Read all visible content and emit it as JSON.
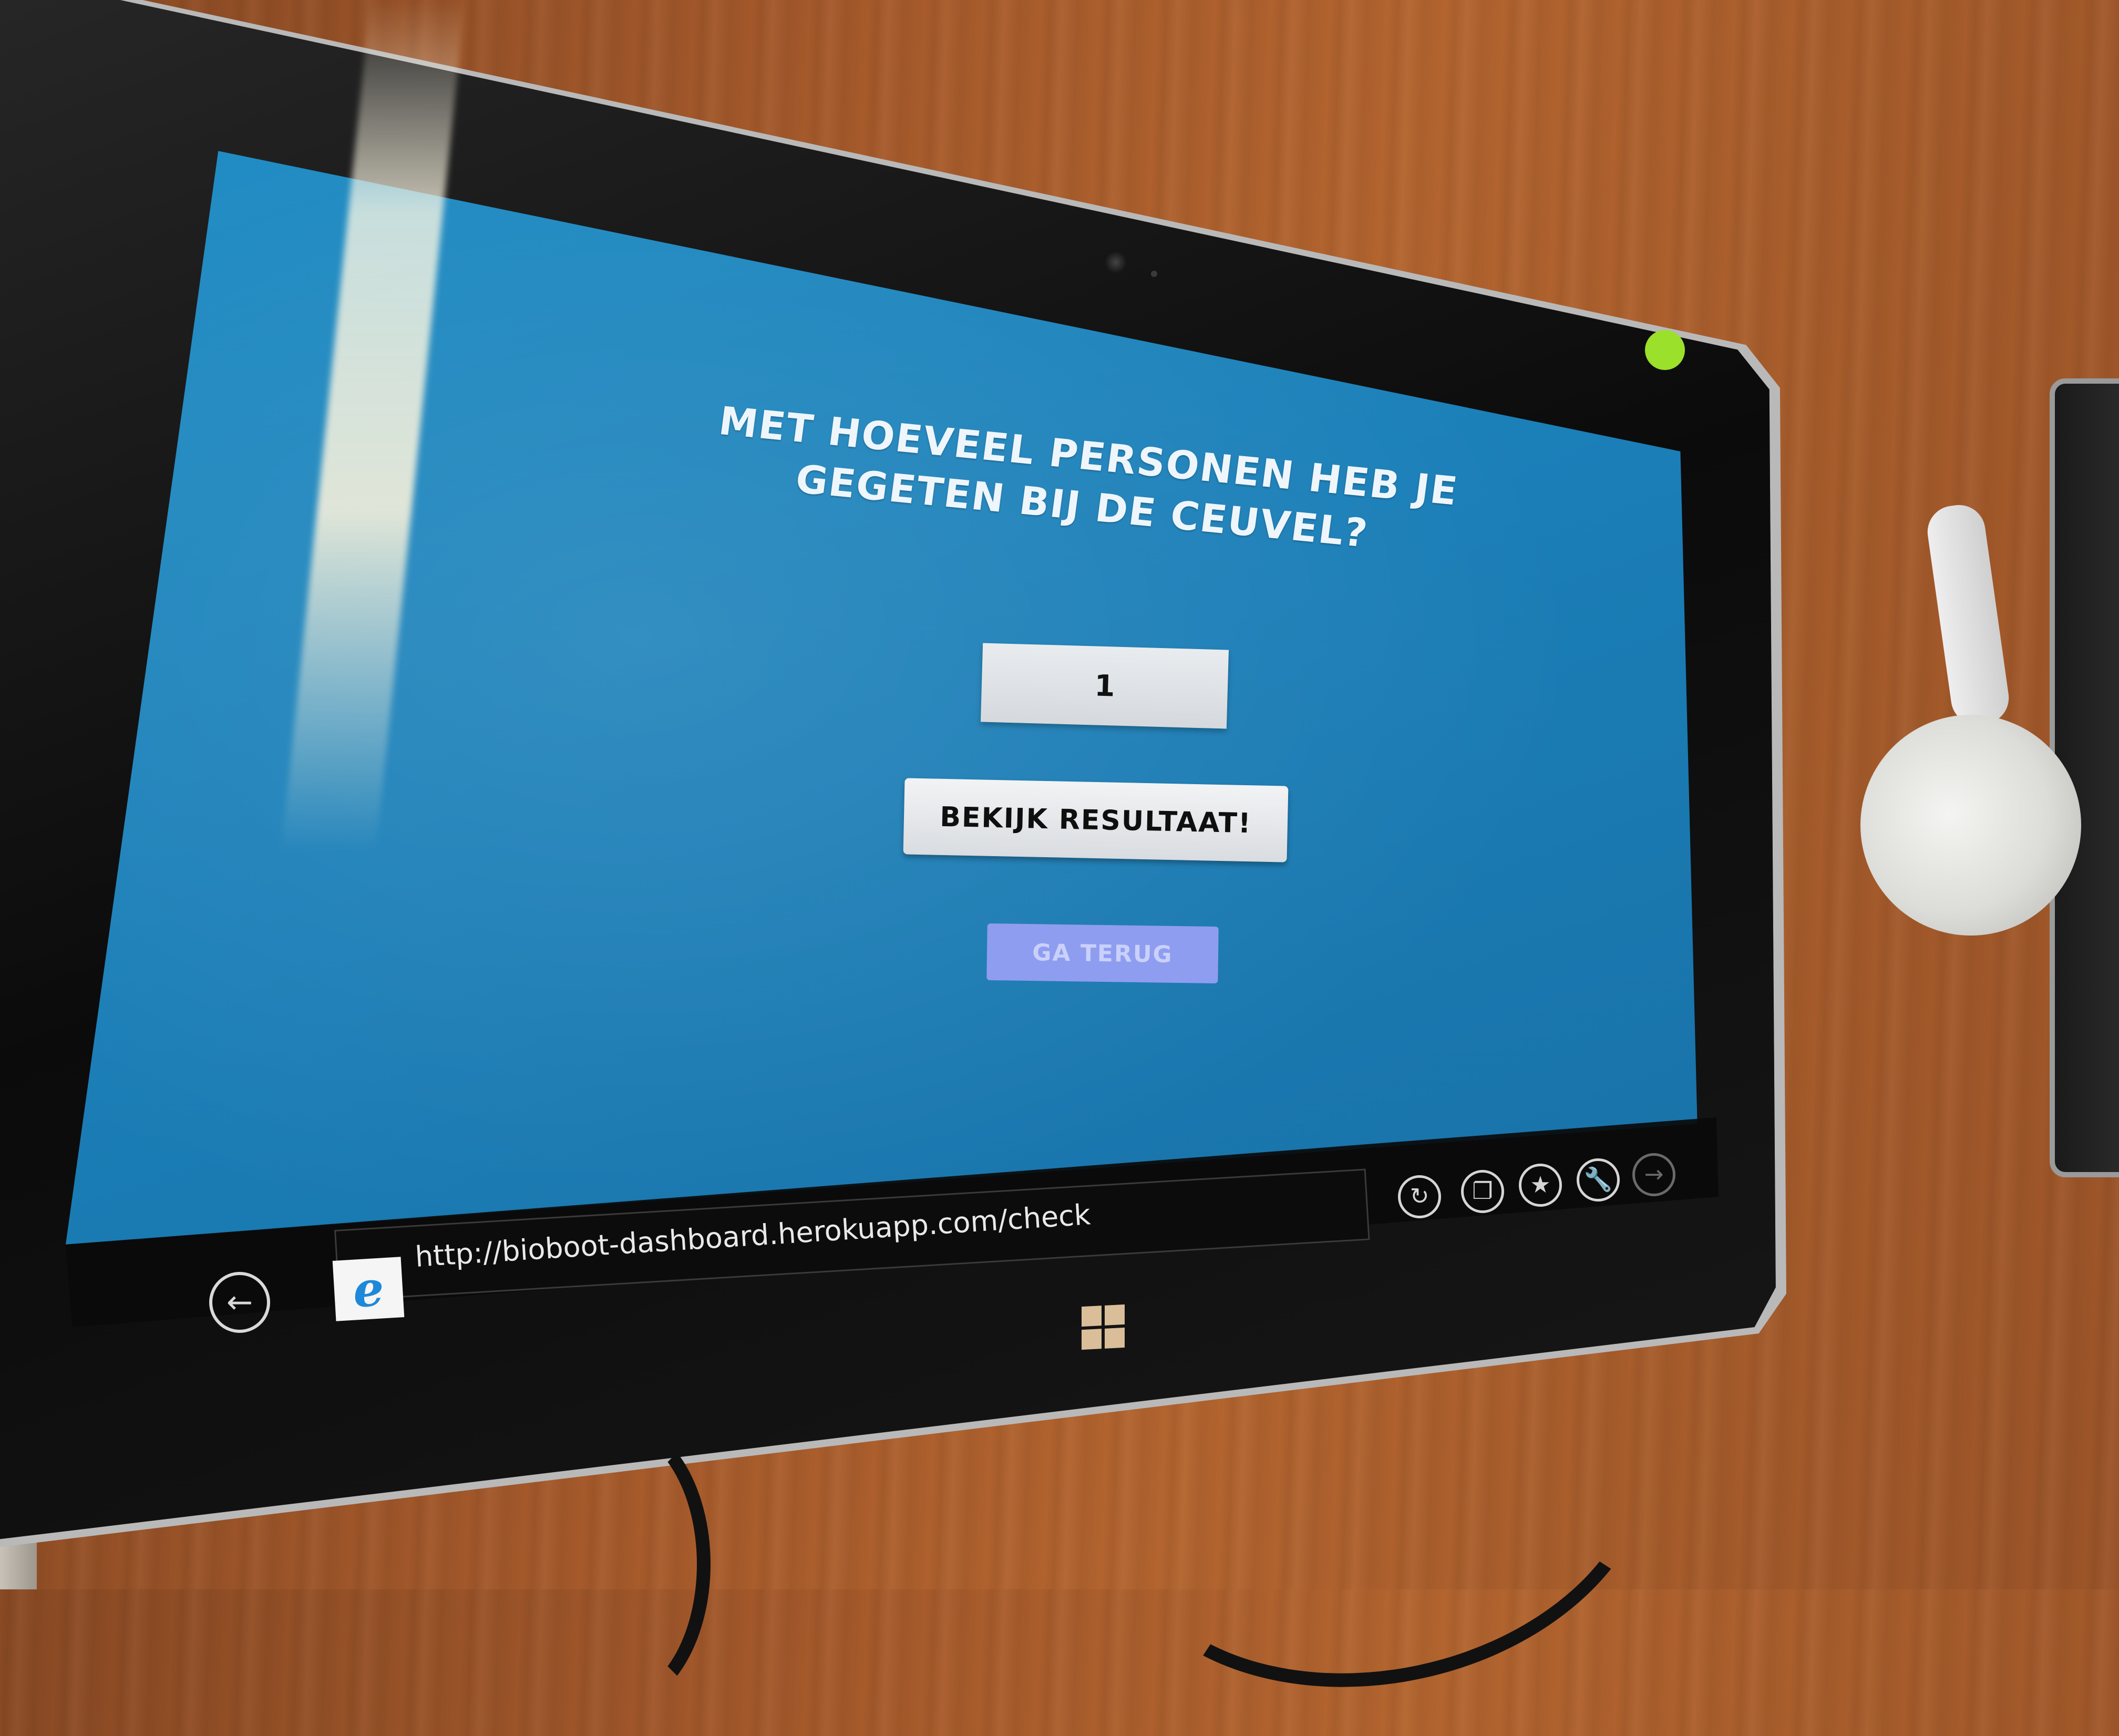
{
  "page": {
    "question": "MET HOEVEEL PERSONEN HEB JE GEGETEN BIJ DE CEUVEL?",
    "persons_value": "1",
    "result_button_label": "BEKIJK RESULTAAT!",
    "back_button_label": "GA TERUG"
  },
  "browser": {
    "url": "http://bioboot-dashboard.herokuapp.com/check",
    "app_icon_glyph": "e",
    "app_icon": "internet-explorer-icon",
    "back_glyph": "←",
    "toolbar": [
      {
        "name": "refresh-icon",
        "glyph": "↻"
      },
      {
        "name": "tabs-icon",
        "glyph": "❐"
      },
      {
        "name": "favorites-icon",
        "glyph": "★"
      },
      {
        "name": "tools-icon",
        "glyph": "🔧"
      },
      {
        "name": "forward-icon",
        "glyph": "→"
      }
    ]
  },
  "colors": {
    "screen_blue": "#1b7eb7",
    "primary_button": "#e4e6e9",
    "back_button": "#8f9df0",
    "ie_blue": "#1e88d9",
    "sticker_green": "#9be02b"
  }
}
